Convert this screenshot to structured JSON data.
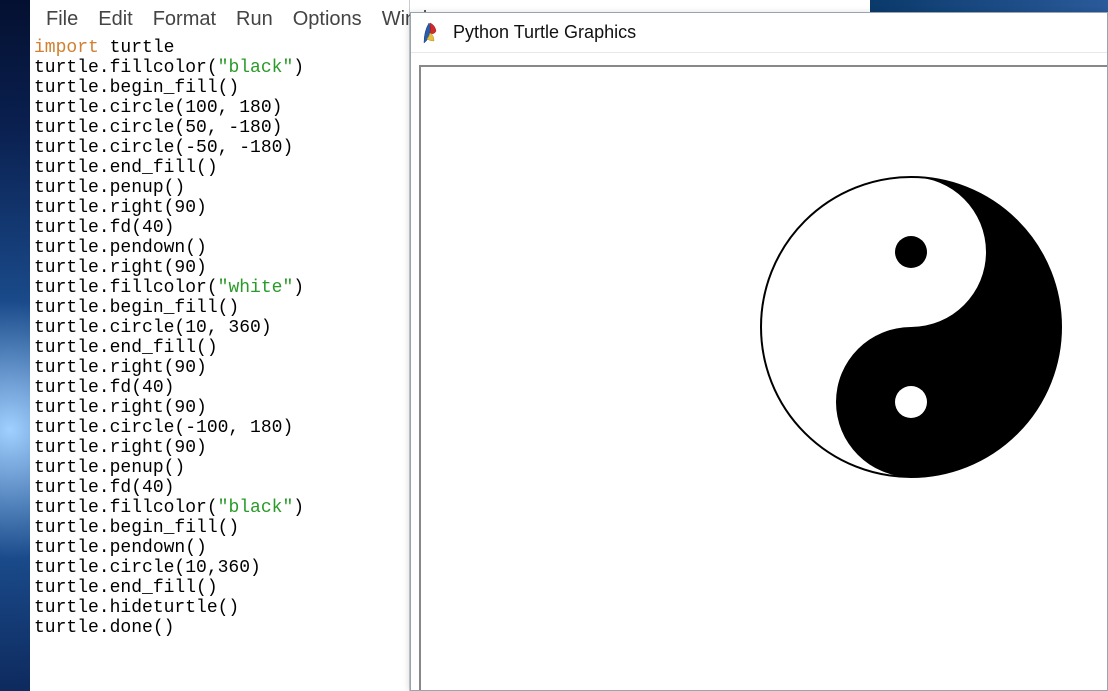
{
  "editor": {
    "menus": [
      "File",
      "Edit",
      "Format",
      "Run",
      "Options",
      "Window"
    ],
    "code": {
      "import_kw": "import",
      "import_mod": " turtle",
      "lines_before_str1": [
        "turtle.fillcolor("
      ],
      "str1": "\"black\"",
      "after_str1": ")",
      "block1": [
        "turtle.begin_fill()",
        "turtle.circle(100, 180)",
        "turtle.circle(50, -180)",
        "turtle.circle(-50, -180)",
        "turtle.end_fill()",
        "turtle.penup()",
        "turtle.right(90)",
        "turtle.fd(40)",
        "turtle.pendown()",
        "turtle.right(90)",
        "turtle.fillcolor("
      ],
      "str2": "\"white\"",
      "after_str2": ")",
      "block2": [
        "turtle.begin_fill()",
        "turtle.circle(10, 360)",
        "turtle.end_fill()",
        "turtle.right(90)",
        "turtle.fd(40)",
        "turtle.right(90)",
        "turtle.circle(-100, 180)",
        "turtle.right(90)",
        "turtle.penup()",
        "turtle.fd(40)",
        "turtle.fillcolor("
      ],
      "str3": "\"black\"",
      "after_str3": ")",
      "block3": [
        "turtle.begin_fill()",
        "turtle.pendown()",
        "turtle.circle(10,360)",
        "turtle.end_fill()",
        "turtle.hideturtle()",
        "turtle.done()"
      ]
    }
  },
  "turtle_window": {
    "title": "Python Turtle Graphics"
  }
}
